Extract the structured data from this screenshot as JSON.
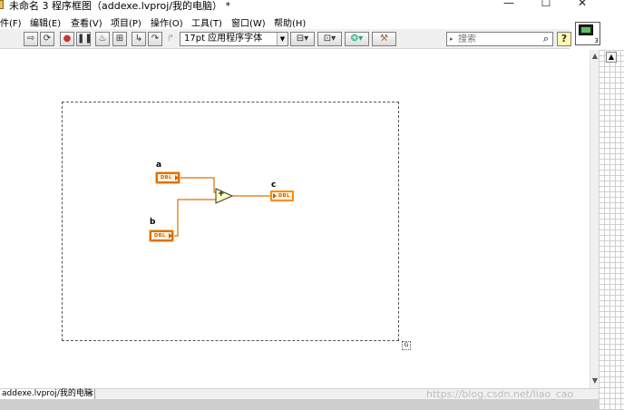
{
  "window": {
    "title": "未命名 3 程序框图（addexe.lvproj/我的电脑） *",
    "minimize": "—",
    "maximize": "☐",
    "close": "✕"
  },
  "menu": {
    "items": [
      "件(F)",
      "编辑(E)",
      "查看(V)",
      "项目(P)",
      "操作(O)",
      "工具(T)",
      "窗口(W)",
      "帮助(H)"
    ]
  },
  "toolbar": {
    "font": "17pt 应用程序字体",
    "search_placeholder": "搜索",
    "help": "?"
  },
  "connector": {
    "number": "3"
  },
  "diagram": {
    "a_label": "a",
    "b_label": "b",
    "c_label": "c",
    "a_type": "DBL",
    "b_type": "DBL",
    "c_type": "DBL",
    "add_symbol": "+",
    "wire_color": "#e07000",
    "terminal_color": "#ff8c00"
  },
  "status": {
    "project": "addexe.lvproj/我的电脑",
    "watermark": "https://blog.csdn.net/liao_cao"
  }
}
